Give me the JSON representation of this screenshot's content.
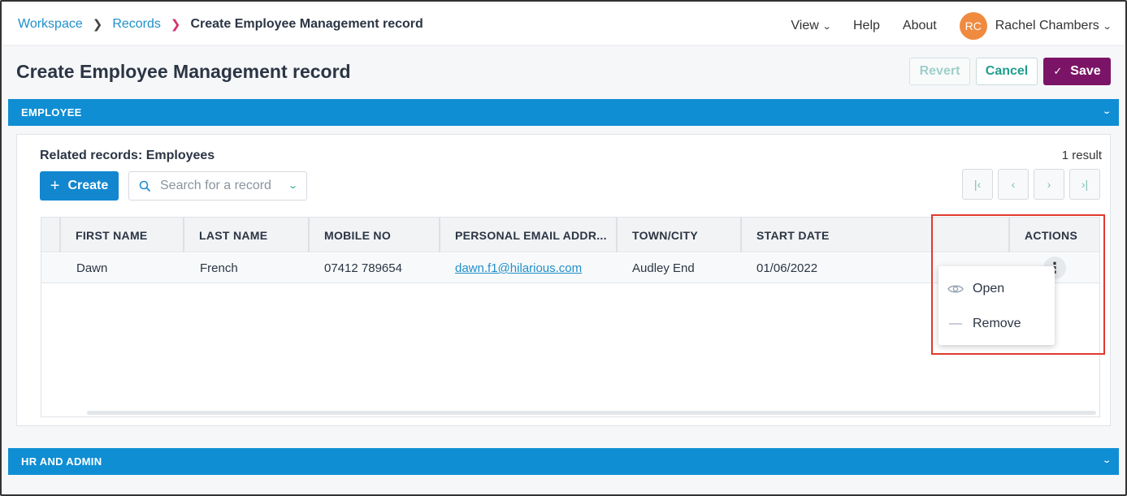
{
  "breadcrumb": {
    "workspace": "Workspace",
    "records": "Records",
    "current": "Create Employee Management record"
  },
  "topnav": {
    "view": "View",
    "help": "Help",
    "about": "About",
    "user_initials": "RC",
    "user_name": "Rachel Chambers"
  },
  "page": {
    "title": "Create Employee Management record",
    "revert_label": "Revert",
    "cancel_label": "Cancel",
    "save_label": "Save"
  },
  "sections": {
    "employee": "EMPLOYEE",
    "hr_admin": "HR AND ADMIN"
  },
  "related": {
    "title": "Related records: Employees",
    "result_count": "1 result",
    "create_label": "Create",
    "search_placeholder": "Search for a record"
  },
  "table": {
    "columns": [
      "FIRST NAME",
      "LAST NAME",
      "MOBILE NO",
      "PERSONAL EMAIL ADDR...",
      "TOWN/CITY",
      "START DATE",
      "ACTIONS"
    ],
    "rows": [
      {
        "first_name": "Dawn",
        "last_name": "French",
        "mobile": "07412 789654",
        "email": "dawn.f1@hilarious.com",
        "town": "Audley End",
        "start_date": "01/06/2022"
      }
    ]
  },
  "actions_menu": {
    "open": "Open",
    "remove": "Remove"
  },
  "colors": {
    "accent_blue": "#0f8ed4",
    "link": "#1f8fcb",
    "save": "#7b1466",
    "teal": "#1f9e8e",
    "avatar": "#f08a3e",
    "highlight": "#e0392e"
  }
}
